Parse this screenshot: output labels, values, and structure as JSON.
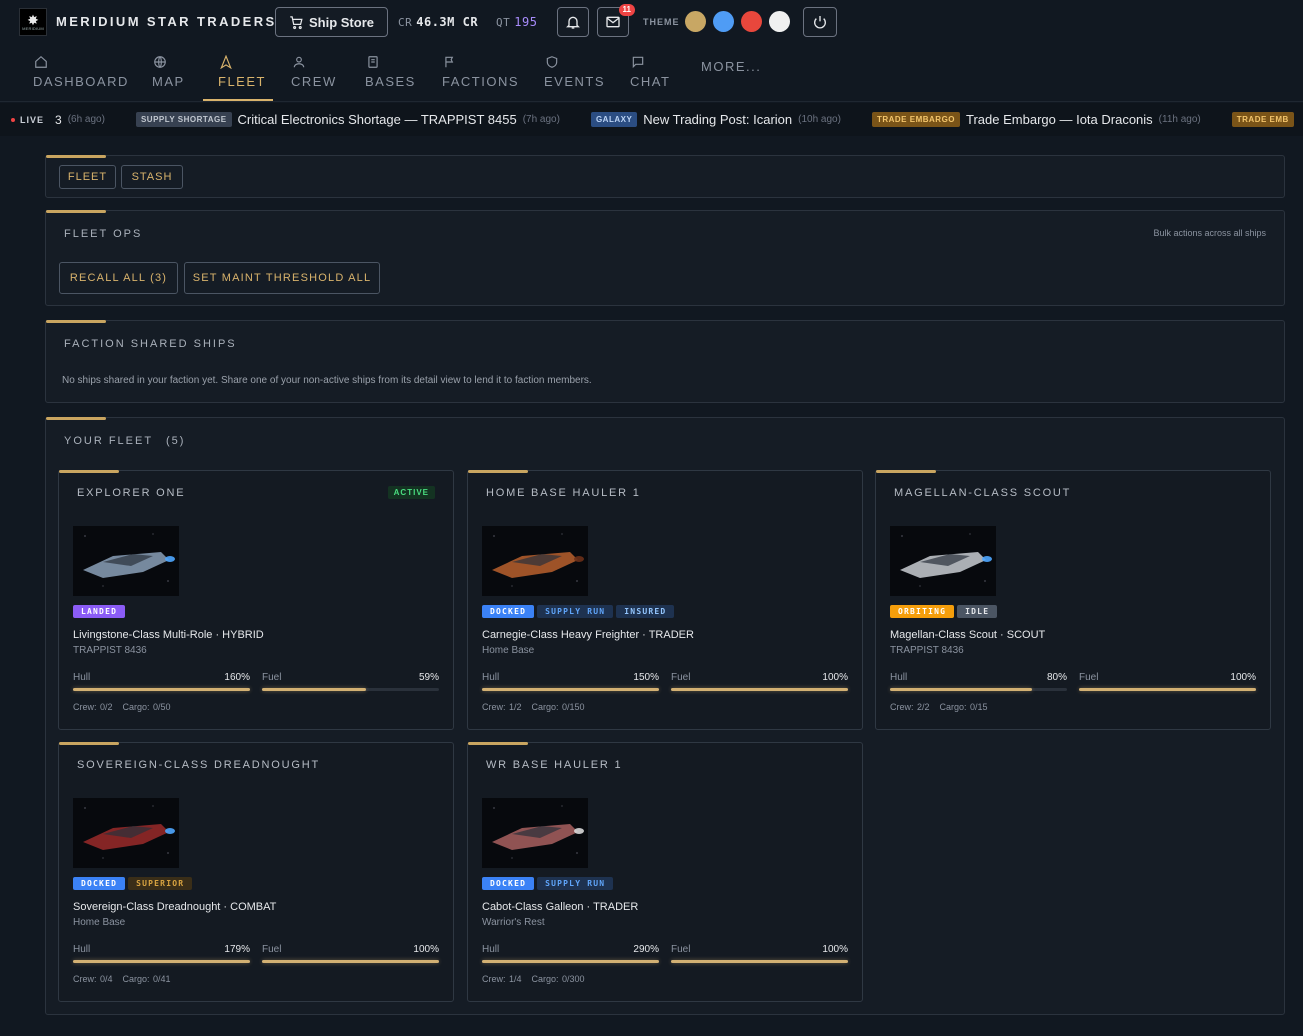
{
  "header": {
    "logo_icon": "star-logo-icon",
    "logo_text": "MERIDIUM",
    "brand": "MERIDIUM STAR TRADERS",
    "ship_store": "Ship Store",
    "cr_label": "CR",
    "cr_value": "46.3M CR",
    "qt_label": "QT",
    "qt_value": "195",
    "mail_count": "11",
    "theme_label": "THEME",
    "theme_colors": [
      "#c8a764",
      "#4f9cf5",
      "#e8473c",
      "#f0f0f0"
    ]
  },
  "nav": {
    "items": [
      {
        "label": "DASHBOARD",
        "icon": "home-icon"
      },
      {
        "label": "MAP",
        "icon": "globe-icon"
      },
      {
        "label": "FLEET",
        "icon": "fleet-icon"
      },
      {
        "label": "CREW",
        "icon": "user-icon"
      },
      {
        "label": "BASES",
        "icon": "document-icon"
      },
      {
        "label": "FACTIONS",
        "icon": "flag-icon"
      },
      {
        "label": "EVENTS",
        "icon": "shield-icon"
      },
      {
        "label": "CHAT",
        "icon": "chat-icon"
      },
      {
        "label": "MORE..."
      }
    ],
    "active": "FLEET"
  },
  "ticker": {
    "live": "LIVE",
    "count": "3",
    "count_ago": "(6h ago)",
    "items": [
      {
        "tag": "SUPPLY SHORTAGE",
        "text": "Critical Electronics Shortage — TRAPPIST 8455",
        "ago": "(7h ago)"
      },
      {
        "tag": "GALAXY",
        "text": "New Trading Post: Icarion",
        "ago": "(10h ago)"
      },
      {
        "tag": "TRADE EMBARGO",
        "text": "Trade Embargo — Iota Draconis",
        "ago": "(11h ago)"
      },
      {
        "tag": "TRADE EMB"
      }
    ]
  },
  "tabs": {
    "fleet": "FLEET",
    "stash": "STASH"
  },
  "fleet_ops": {
    "title": "FLEET OPS",
    "hint": "Bulk actions across all ships",
    "recall": "RECALL ALL (3)",
    "maint": "SET MAINT THRESHOLD ALL"
  },
  "shared": {
    "title": "FACTION SHARED SHIPS",
    "message": "No ships shared in your faction yet. Share one of your non-active ships from its detail view to lend it to faction members."
  },
  "your_fleet": {
    "title": "YOUR FLEET",
    "count": "(5)"
  },
  "labels": {
    "hull": "Hull",
    "fuel": "Fuel"
  },
  "ships": [
    {
      "name": "EXPLORER ONE",
      "active": "ACTIVE",
      "badges": [
        "LANDED"
      ],
      "class": "Livingstone-Class Multi-Role · HYBRID",
      "location": "TRAPPIST 8436",
      "hull": "160%",
      "hull_fill": 1.0,
      "fuel": "59%",
      "fuel_fill": 0.59,
      "crew": "Crew: 0/2",
      "cargo": "Cargo: 0/50"
    },
    {
      "name": "HOME BASE HAULER 1",
      "badges": [
        "DOCKED",
        "SUPPLY RUN",
        "INSURED"
      ],
      "class": "Carnegie-Class Heavy Freighter · TRADER",
      "location": "Home Base",
      "hull": "150%",
      "hull_fill": 1.0,
      "fuel": "100%",
      "fuel_fill": 1.0,
      "crew": "Crew: 1/2",
      "cargo": "Cargo: 0/150"
    },
    {
      "name": "MAGELLAN-CLASS SCOUT",
      "badges": [
        "ORBITING",
        "IDLE"
      ],
      "class": "Magellan-Class Scout · SCOUT",
      "location": "TRAPPIST 8436",
      "hull": "80%",
      "hull_fill": 0.8,
      "fuel": "100%",
      "fuel_fill": 1.0,
      "crew": "Crew: 2/2",
      "cargo": "Cargo: 0/15"
    },
    {
      "name": "SOVEREIGN-CLASS DREADNOUGHT",
      "badges": [
        "DOCKED",
        "SUPERIOR"
      ],
      "class": "Sovereign-Class Dreadnought · COMBAT",
      "location": "Home Base",
      "hull": "179%",
      "hull_fill": 1.0,
      "fuel": "100%",
      "fuel_fill": 1.0,
      "crew": "Crew: 0/4",
      "cargo": "Cargo: 0/41"
    },
    {
      "name": "WR BASE HAULER 1",
      "badges": [
        "DOCKED",
        "SUPPLY RUN"
      ],
      "class": "Cabot-Class Galleon · TRADER",
      "location": "Warrior's Rest",
      "hull": "290%",
      "hull_fill": 1.0,
      "fuel": "100%",
      "fuel_fill": 1.0,
      "crew": "Crew: 1/4",
      "cargo": "Cargo: 0/300"
    }
  ]
}
